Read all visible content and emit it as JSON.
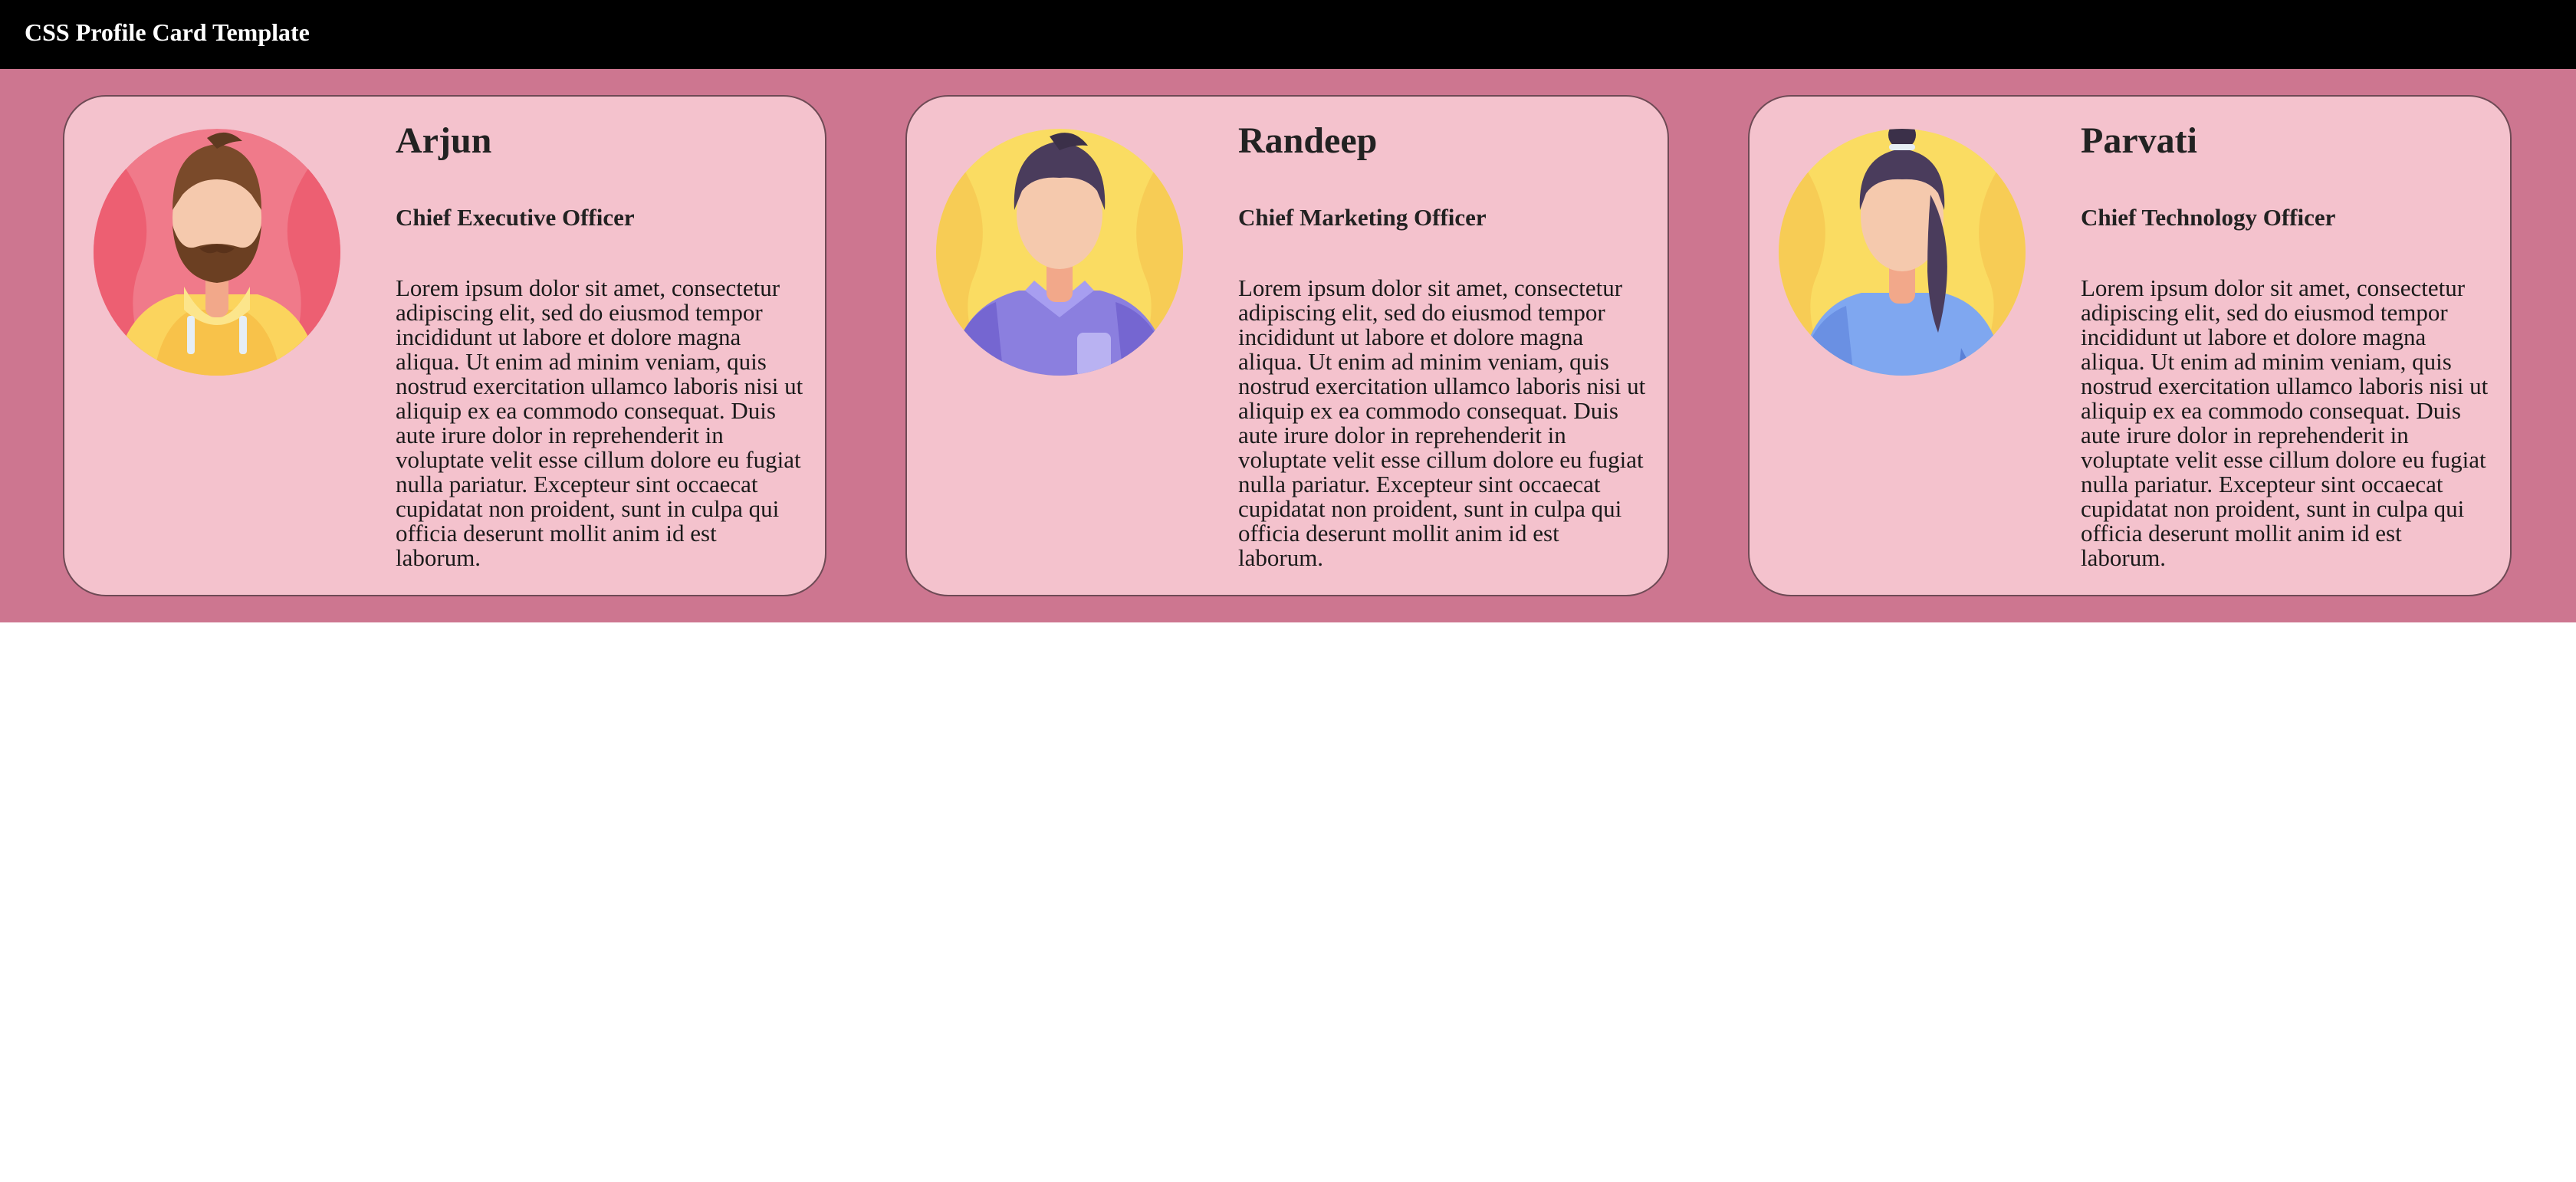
{
  "header": {
    "title": "CSS Profile Card Template"
  },
  "colors": {
    "header_bg": "#000000",
    "band_bg": "#cd7690",
    "card_bg": "#f4c2cd",
    "card_border": "#6e4a55"
  },
  "cards": [
    {
      "name": "Arjun",
      "role": "Chief Executive Officer",
      "bio": "Lorem ipsum dolor sit amet, consectetur adipiscing elit, sed do eiusmod tempor incididunt ut labore et dolore magna aliqua. Ut enim ad minim veniam, quis nostrud exercitation ullamco laboris nisi ut aliquip ex ea commodo consequat. Duis aute irure dolor in reprehenderit in voluptate velit esse cillum dolore eu fugiat nulla pariatur. Excepteur sint occaecat cupidatat non proident, sunt in culpa qui officia deserunt mollit anim id est laborum.",
      "avatar": "bearded-man-avatar-icon"
    },
    {
      "name": "Randeep",
      "role": "Chief Marketing Officer",
      "bio": "Lorem ipsum dolor sit amet, consectetur adipiscing elit, sed do eiusmod tempor incididunt ut labore et dolore magna aliqua. Ut enim ad minim veniam, quis nostrud exercitation ullamco laboris nisi ut aliquip ex ea commodo consequat. Duis aute irure dolor in reprehenderit in voluptate velit esse cillum dolore eu fugiat nulla pariatur. Excepteur sint occaecat cupidatat non proident, sunt in culpa qui officia deserunt mollit anim id est laborum.",
      "avatar": "man-shirt-avatar-icon"
    },
    {
      "name": "Parvati",
      "role": "Chief Technology Officer",
      "bio": "Lorem ipsum dolor sit amet, consectetur adipiscing elit, sed do eiusmod tempor incididunt ut labore et dolore magna aliqua. Ut enim ad minim veniam, quis nostrud exercitation ullamco laboris nisi ut aliquip ex ea commodo consequat. Duis aute irure dolor in reprehenderit in voluptate velit esse cillum dolore eu fugiat nulla pariatur. Excepteur sint occaecat cupidatat non proident, sunt in culpa qui officia deserunt mollit anim id est laborum.",
      "avatar": "woman-ponytail-avatar-icon"
    }
  ]
}
